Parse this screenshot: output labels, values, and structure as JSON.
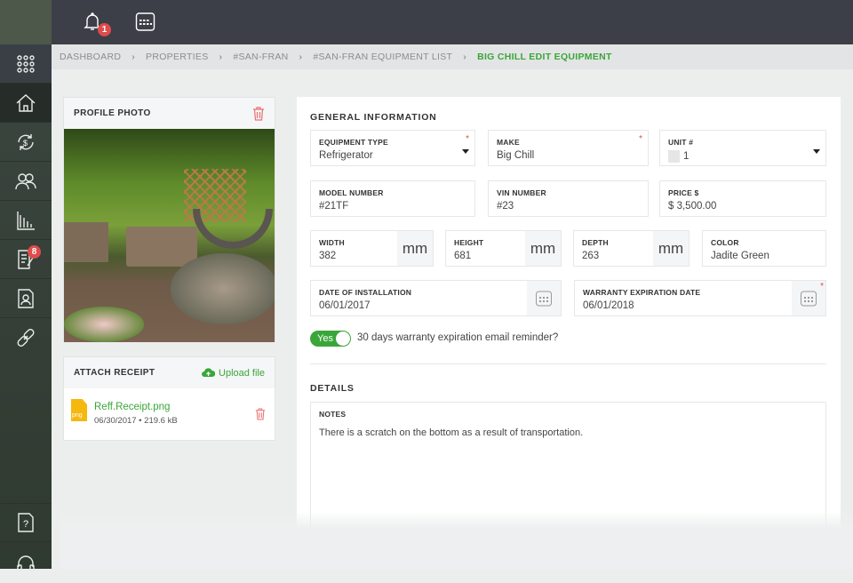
{
  "header": {
    "notification_count": "1"
  },
  "sidebar": {
    "items": [
      "apps",
      "properties",
      "payments",
      "tenants",
      "reports",
      "tasks",
      "contacts",
      "links"
    ],
    "tasks_badge": "8",
    "bottom": [
      "help",
      "support"
    ]
  },
  "breadcrumb": [
    "DASHBOARD",
    "PROPERTIES",
    "#SAN-FRAN",
    "#SAN-FRAN EQUIPMENT LIST"
  ],
  "breadcrumb_current": "BIG CHILL EDIT EQUIPMENT",
  "profile_photo": {
    "title": "PROFILE PHOTO"
  },
  "receipt": {
    "title": "ATTACH RECEIPT",
    "upload": "Upload file",
    "file_name": "Reff.Receipt.png",
    "file_ext": "png",
    "file_date": "06/30/2017",
    "file_size": "219.6 kB"
  },
  "general": {
    "title": "GENERAL INFORMATION",
    "equipment_type": {
      "label": "EQUIPMENT TYPE",
      "value": "Refrigerator"
    },
    "make": {
      "label": "MAKE",
      "value": "Big Chill"
    },
    "unit": {
      "label": "UNIT #",
      "value": "1"
    },
    "model": {
      "label": "MODEL NUMBER",
      "value": "#21TF"
    },
    "vin": {
      "label": "VIN NUMBER",
      "value": "#23"
    },
    "price": {
      "label": "PRICE $",
      "value": "$ 3,500.00"
    },
    "width": {
      "label": "WIDTH",
      "value": "382",
      "unit": "mm"
    },
    "height": {
      "label": "HEIGHT",
      "value": "681",
      "unit": "mm"
    },
    "depth": {
      "label": "DEPTH",
      "value": "263",
      "unit": "mm"
    },
    "color": {
      "label": "COLOR",
      "value": "Jadite Green"
    },
    "install": {
      "label": "DATE OF INSTALLATION",
      "value": "06/01/2017"
    },
    "warranty": {
      "label": "WARRANTY EXPIRATION DATE",
      "value": "06/01/2018"
    },
    "toggle": {
      "label": "Yes",
      "text": "30 days warranty expiration email reminder?"
    }
  },
  "details": {
    "title": "DETAILS",
    "notes_label": "NOTES",
    "notes": "There is a scratch on the bottom as a result of transportation."
  },
  "colors": {
    "accent": "#3aa63a",
    "danger": "#e04b4b",
    "topbar": "#3c3f47"
  }
}
